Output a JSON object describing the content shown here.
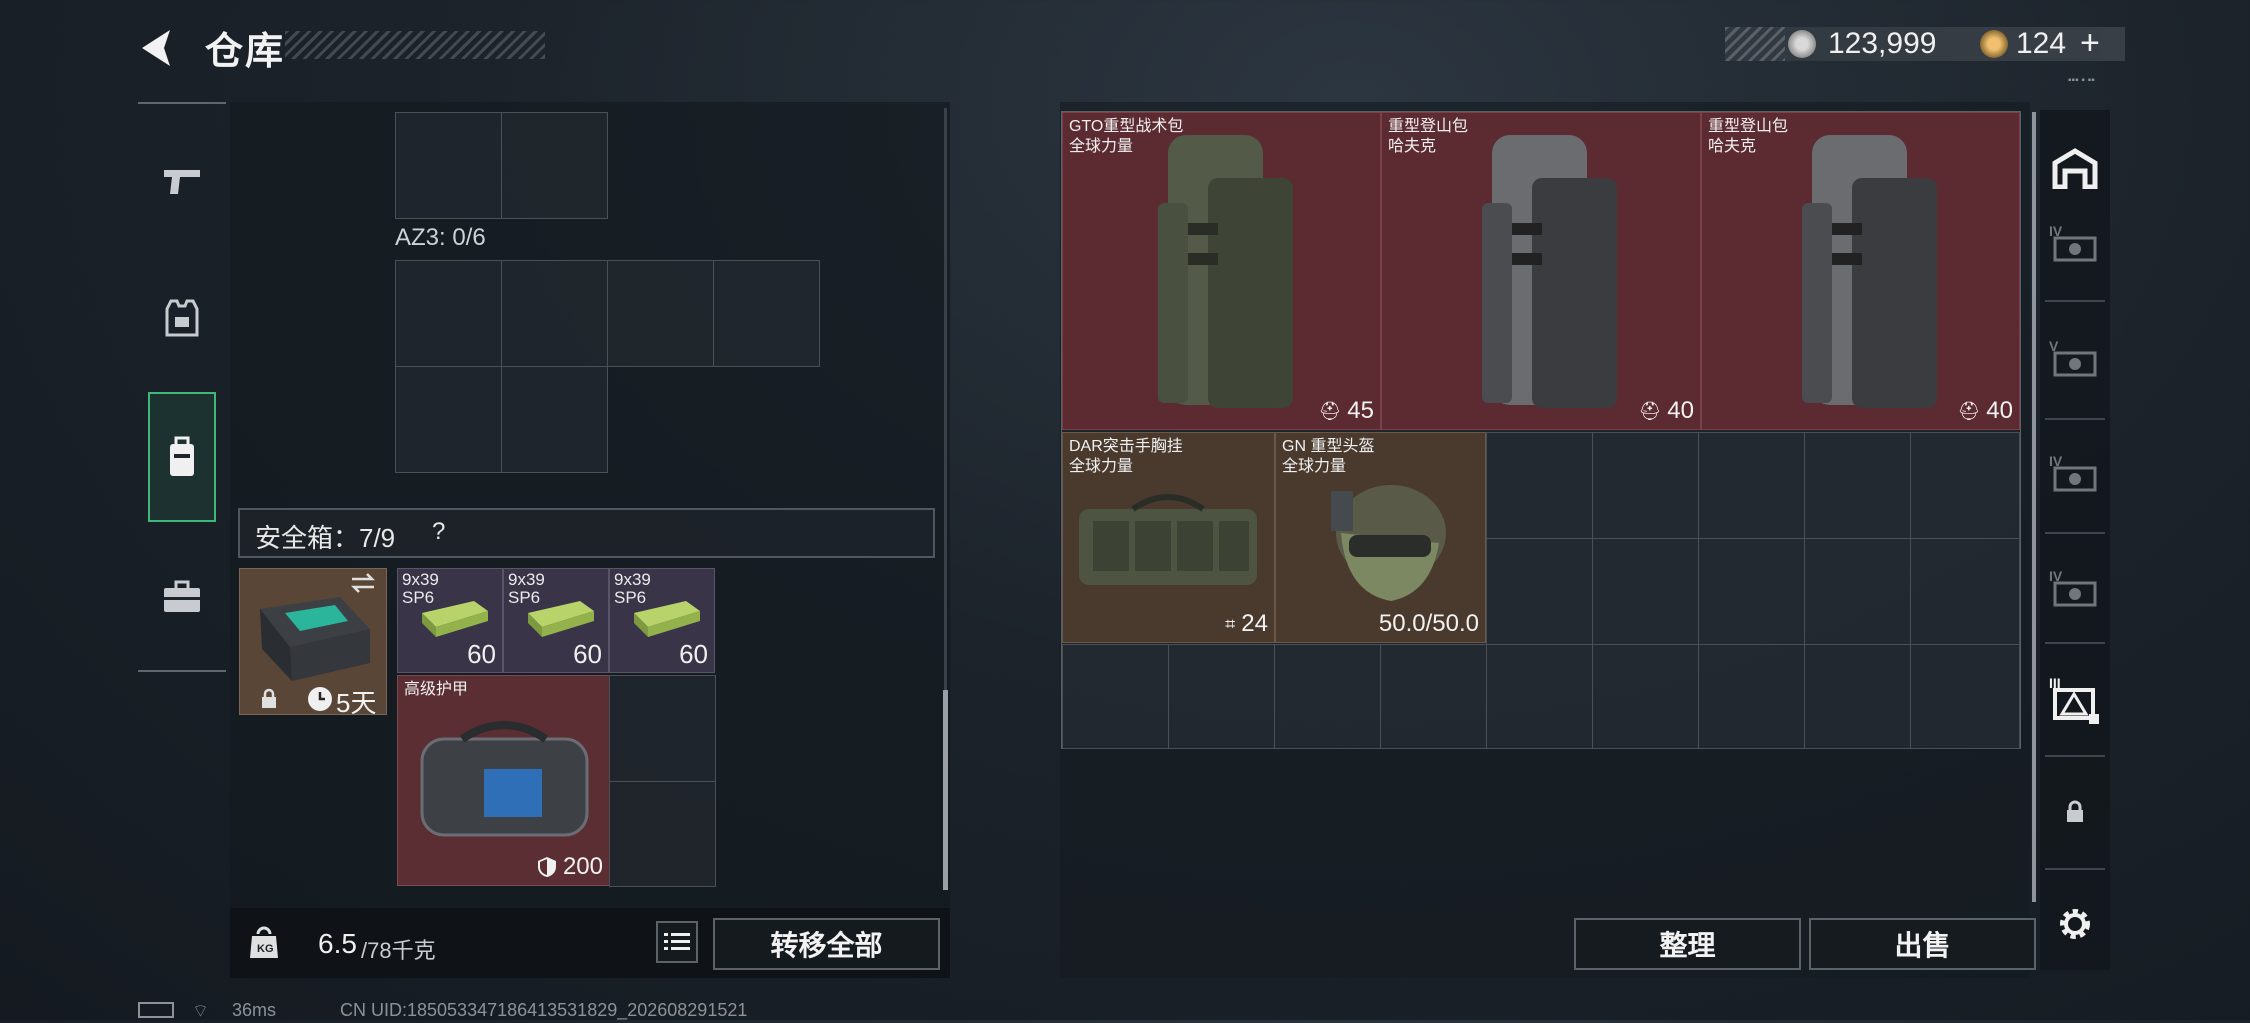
{
  "header": {
    "title": "仓库",
    "silver": "123,999",
    "gold": "124",
    "gold_add": "+"
  },
  "left_nav": [
    {
      "name": "pistol-icon"
    },
    {
      "name": "armor-vest-icon"
    },
    {
      "name": "backpack-icon",
      "active": true
    },
    {
      "name": "briefcase-icon"
    }
  ],
  "inventory": {
    "az3_label": "AZ3: 0/6",
    "safebox_label": "安全箱：7/9",
    "safebox_help": "?",
    "safebox_slot": {
      "timer": "5天"
    },
    "ammo": [
      {
        "line1": "9x39",
        "line2": "SP6",
        "count": "60"
      },
      {
        "line1": "9x39",
        "line2": "SP6",
        "count": "60"
      },
      {
        "line1": "9x39",
        "line2": "SP6",
        "count": "60"
      }
    ],
    "armor_item": {
      "name": "高级护甲",
      "value": "200"
    },
    "weight": {
      "current": "6.5",
      "max": "/78千克"
    },
    "transfer_all": "转移全部"
  },
  "storage": {
    "items": [
      {
        "name_l1": "GTO重型战术包",
        "name_l2": "全球力量",
        "value": "45"
      },
      {
        "name_l1": "重型登山包",
        "name_l2": "哈夫克",
        "value": "40"
      },
      {
        "name_l1": "重型登山包",
        "name_l2": "哈夫克",
        "value": "40"
      },
      {
        "name_l1": "DAR突击手胸挂",
        "name_l2": "全球力量",
        "value": "24"
      },
      {
        "name_l1": "GN 重型头盔",
        "name_l2": "全球力量",
        "value": "50.0/50.0"
      }
    ],
    "sort_button": "整理",
    "sell_button": "出售"
  },
  "right_nav": [
    {
      "name": "warehouse-icon"
    },
    {
      "name": "storage-tab-iv-icon",
      "label": "IV"
    },
    {
      "name": "storage-tab-v-icon",
      "label": "V"
    },
    {
      "name": "storage-tab-iv-icon",
      "label": "IV"
    },
    {
      "name": "storage-tab-iv-icon",
      "label": "IV"
    },
    {
      "name": "storage-tab-iii-icon",
      "label": "III"
    },
    {
      "name": "lock-icon"
    },
    {
      "name": "settings-icon"
    }
  ],
  "status_bar": {
    "ping": "36ms",
    "uid": "CN UID:1850533471864135318​29_202608291521"
  },
  "colors": {
    "accent_green": "#3fb87a",
    "item_red": "#5c2a31",
    "item_brown": "#4a3a2e",
    "ammo_purple": "#3a3448"
  }
}
